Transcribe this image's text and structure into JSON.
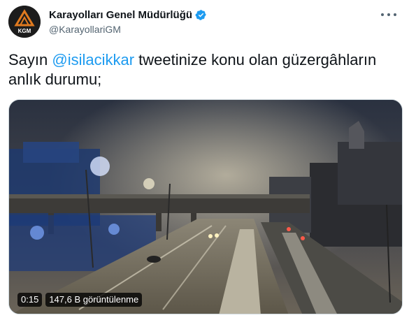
{
  "author": {
    "display_name": "Karayolları Genel Müdürlüğü",
    "handle": "@KarayollariGM",
    "avatar_text": "KGM",
    "verified": true
  },
  "tweet": {
    "prefix": "Sayın ",
    "mention": "@isilacikkar",
    "suffix": " tweetinize konu olan güzergâhların anlık durumu;"
  },
  "media": {
    "duration": "0:15",
    "views": "147,6 B görüntülenme"
  },
  "colors": {
    "accent": "#1d9bf0",
    "text": "#0f1419",
    "secondary": "#536471"
  },
  "icons": [
    "verified-badge-icon",
    "more-options-icon"
  ]
}
